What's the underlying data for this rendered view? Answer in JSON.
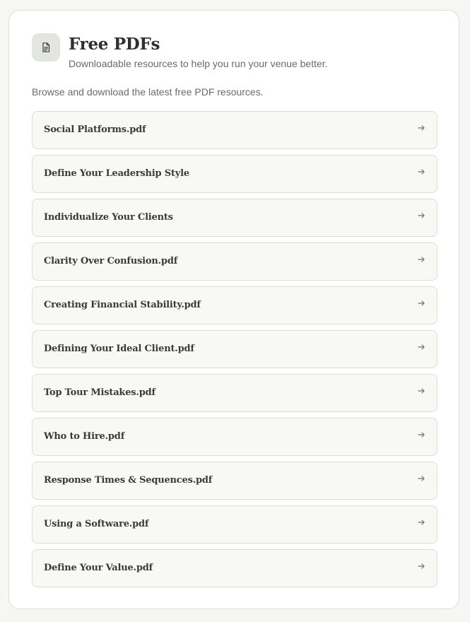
{
  "header": {
    "icon": "document-icon",
    "title": "Free PDFs",
    "subtitle": "Downloadable resources to help you run your venue better."
  },
  "intro": "Browse and download the latest free PDF resources.",
  "resources": [
    {
      "label": "Social Platforms.pdf"
    },
    {
      "label": "Define Your Leadership Style"
    },
    {
      "label": "Individualize Your Clients"
    },
    {
      "label": "Clarity Over Confusion.pdf"
    },
    {
      "label": "Creating Financial Stability.pdf"
    },
    {
      "label": "Defining Your Ideal Client.pdf"
    },
    {
      "label": "Top Tour Mistakes.pdf"
    },
    {
      "label": "Who to Hire.pdf"
    },
    {
      "label": "Response Times & Sequences.pdf"
    },
    {
      "label": "Using a Software.pdf"
    },
    {
      "label": "Define Your Value.pdf"
    }
  ],
  "item_icon": "arrow-right-icon",
  "colors": {
    "page_background": "#f6f6f3",
    "card_background": "#ffffff",
    "icon_background": "#e3e6df",
    "item_background": "#f8f8f5",
    "accent": "#5f7a62"
  }
}
